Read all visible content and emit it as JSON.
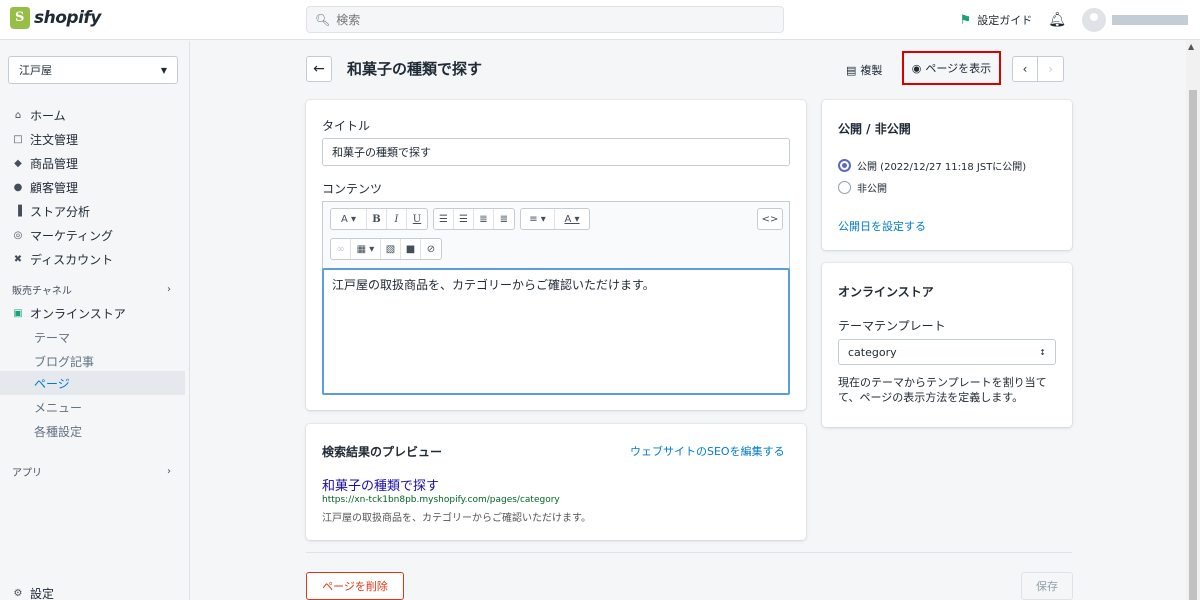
{
  "header": {
    "logo_text": "shopify",
    "search_placeholder": "検索",
    "setup_guide": "設定ガイド"
  },
  "sidebar": {
    "store_name": "江戸屋",
    "items": [
      {
        "label": "ホーム",
        "icon": "home-icon"
      },
      {
        "label": "注文管理",
        "icon": "orders-icon"
      },
      {
        "label": "商品管理",
        "icon": "tag-icon"
      },
      {
        "label": "顧客管理",
        "icon": "person-icon"
      },
      {
        "label": "ストア分析",
        "icon": "analytics-icon"
      },
      {
        "label": "マーケティング",
        "icon": "marketing-icon"
      },
      {
        "label": "ディスカウント",
        "icon": "discount-icon"
      }
    ],
    "sales_channels": "販売チャネル",
    "online_store": "オンラインストア",
    "sub_items": [
      "テーマ",
      "ブログ記事",
      "ページ",
      "メニュー",
      "各種設定"
    ],
    "apps": "アプリ",
    "settings": "設定"
  },
  "page": {
    "title": "和菓子の種類で探す",
    "duplicate": "複製",
    "view_page": "ページを表示"
  },
  "editor": {
    "title_label": "タイトル",
    "title_value": "和菓子の種類で探す",
    "content_label": "コンテンツ",
    "content_text": "江戸屋の取扱商品を、カテゴリーからご確認いただけます。"
  },
  "seo": {
    "heading": "検索結果のプレビュー",
    "edit_link": "ウェブサイトのSEOを編集する",
    "preview_title": "和菓子の種類で探す",
    "preview_url": "https://xn-tck1bn8pb.myshopify.com/pages/category",
    "preview_desc": "江戸屋の取扱商品を、カテゴリーからご確認いただけます。"
  },
  "visibility": {
    "heading": "公開 / 非公開",
    "published": "公開 (2022/12/27 11:18 JSTに公開)",
    "hidden": "非公開",
    "set_date": "公開日を設定する"
  },
  "online_store_card": {
    "heading": "オンラインストア",
    "template_label": "テーマテンプレート",
    "template_value": "category",
    "help": "現在のテーマからテンプレートを割り当てて、ページの表示方法を定義します。"
  },
  "footer": {
    "delete": "ページを削除",
    "save": "保存"
  },
  "colors": {
    "accent": "#007ace",
    "danger": "#de3618",
    "highlight": "#d80000",
    "brand": "#95bf47"
  }
}
